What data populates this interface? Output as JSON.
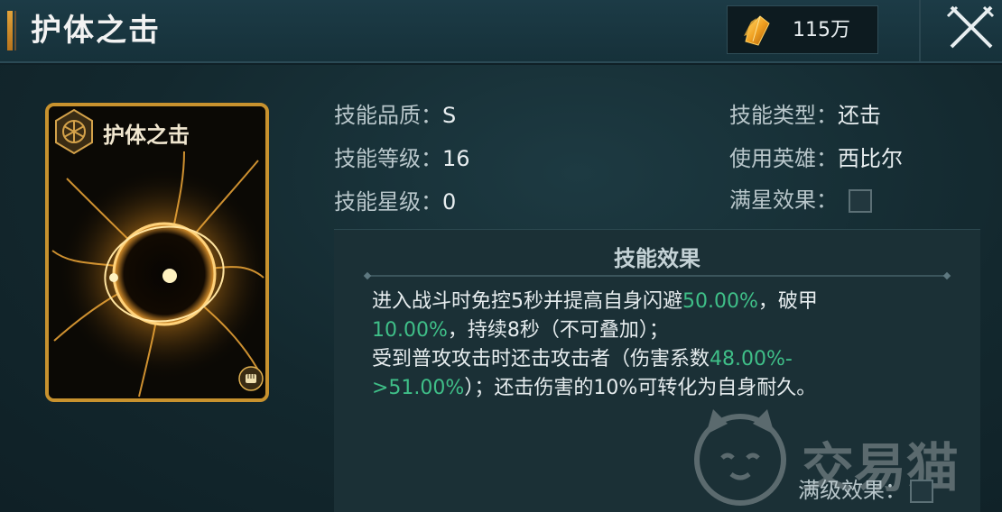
{
  "header": {
    "title": "护体之击",
    "currency_value": "115万",
    "currency_icon": "crystal-icon",
    "close_icon": "close-icon"
  },
  "card": {
    "name": "护体之击",
    "emblem_icon": "hexagon-emblem-icon",
    "badge_icon": "fist-badge-icon"
  },
  "info": {
    "quality_label": "技能品质：",
    "quality_value": "S",
    "level_label": "技能等级：",
    "level_value": "16",
    "star_label": "技能星级：",
    "star_value": "0",
    "type_label": "技能类型：",
    "type_value": "还击",
    "hero_label": "使用英雄：",
    "hero_value": "西比尔",
    "fullstar_label": "满星效果："
  },
  "effect": {
    "title": "技能效果",
    "line1a": "进入战斗时免控5秒并提高自身闪避",
    "line1b": "50.00%",
    "line1c": "，破甲",
    "line2a": "10.00%",
    "line2b": "，持续8秒（不可叠加）；",
    "line3a": "受到普攻攻击时还击攻击者（伤害系数",
    "line3b": "48.00%-",
    "line4a": ">51.00%",
    "line4b": "）；还击伤害的10%可转化为自身耐久。"
  },
  "footer": {
    "maxlevel_label": "满级效果："
  },
  "watermark": {
    "text": "交易猫"
  },
  "colors": {
    "accent": "#c8922e",
    "highlight": "#3fbf88"
  }
}
